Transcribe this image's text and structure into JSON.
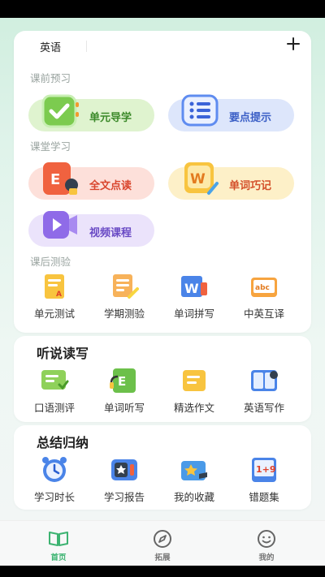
{
  "subject": {
    "label": "英语"
  },
  "sections": {
    "preview": "课前预习",
    "classroom": "课堂学习",
    "after": "课后测验"
  },
  "preview_items": [
    {
      "label": "单元导学",
      "icon": "checkmark-book-icon"
    },
    {
      "label": "要点提示",
      "icon": "list-icon"
    }
  ],
  "classroom_items": [
    {
      "label": "全文点读",
      "icon": "reading-pen-icon"
    },
    {
      "label": "单词巧记",
      "icon": "word-notebook-icon"
    },
    {
      "label": "视频课程",
      "icon": "video-camera-icon"
    }
  ],
  "after_items": [
    {
      "label": "单元测试",
      "icon": "test-paper-icon"
    },
    {
      "label": "学期测验",
      "icon": "exam-paper-icon"
    },
    {
      "label": "单词拼写",
      "icon": "spelling-icon"
    },
    {
      "label": "中英互译",
      "icon": "translation-icon"
    }
  ],
  "listening": {
    "title": "听说读写",
    "items": [
      {
        "label": "口语测评",
        "icon": "speaking-icon"
      },
      {
        "label": "单词听写",
        "icon": "dictation-icon"
      },
      {
        "label": "精选作文",
        "icon": "essay-icon"
      },
      {
        "label": "英语写作",
        "icon": "writing-icon"
      }
    ]
  },
  "summary": {
    "title": "总结归纳",
    "items": [
      {
        "label": "学习时长",
        "icon": "clock-icon"
      },
      {
        "label": "学习报告",
        "icon": "report-icon"
      },
      {
        "label": "我的收藏",
        "icon": "favorites-icon"
      },
      {
        "label": "错题集",
        "icon": "mistakes-book-icon"
      }
    ]
  },
  "tabbar": [
    {
      "label": "首页",
      "icon": "book-icon",
      "active": true
    },
    {
      "label": "拓展",
      "icon": "compass-icon",
      "active": false
    },
    {
      "label": "我的",
      "icon": "smiley-icon",
      "active": false
    }
  ],
  "colors": {
    "accent": "#3cb371"
  }
}
